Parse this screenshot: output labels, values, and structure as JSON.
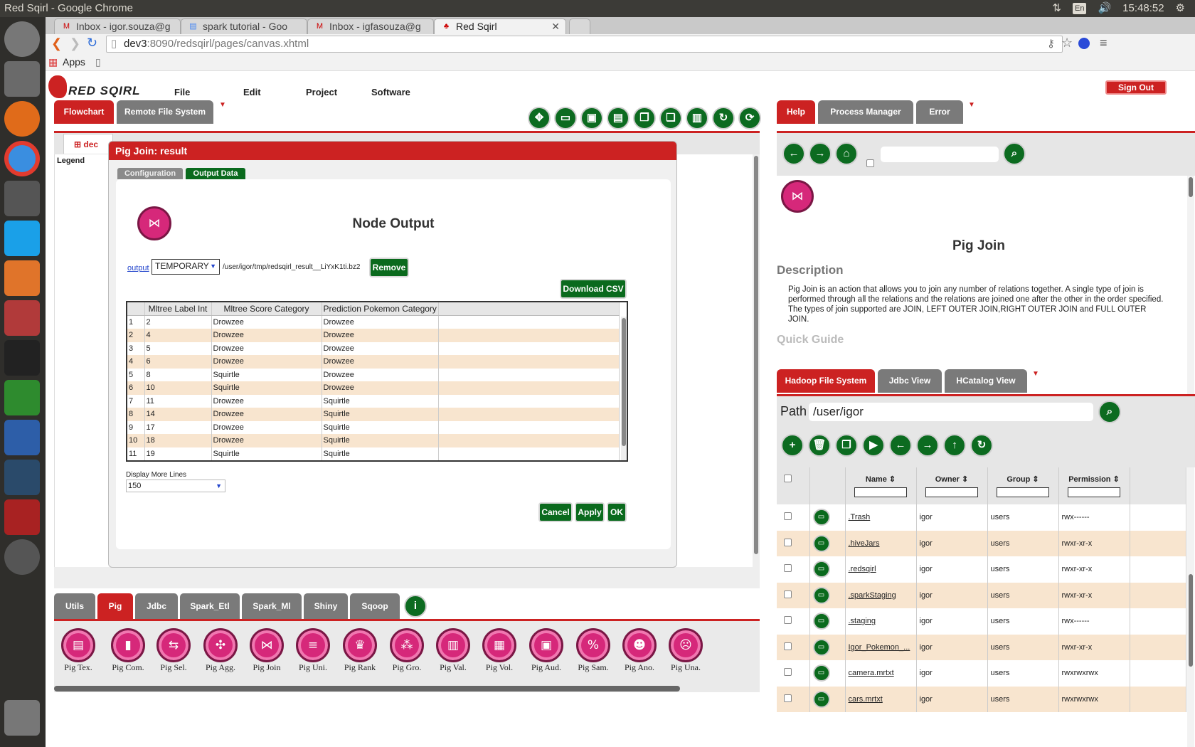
{
  "os": {
    "window_title": "Red Sqirl - Google Chrome",
    "lang": "En",
    "time": "15:48:52"
  },
  "browser": {
    "tabs": [
      {
        "label": "Inbox - igor.souza@g"
      },
      {
        "label": "spark tutorial - Goo"
      },
      {
        "label": "Inbox - igfasouza@g"
      },
      {
        "label": "Red Sqirl"
      }
    ],
    "url_host": "dev3",
    "url_rest": ":8090/redsqirl/pages/canvas.xhtml",
    "apps": "Apps"
  },
  "app": {
    "logo": "RED SQIRL",
    "menu": [
      "File",
      "Edit",
      "Project",
      "Software"
    ],
    "sign_out": "Sign Out",
    "left_tabs": [
      "Flowchart",
      "Remote File System"
    ],
    "canvas_tab": "dec",
    "legend": "Legend",
    "help_tabs": [
      "Help",
      "Process Manager",
      "Error"
    ],
    "help": {
      "title": "Pig Join",
      "desc_heading": "Description",
      "desc": "Pig Join is an action that allows you to join any number of relations together. A single type of join is performed through all the relations and the relations are joined one after the other in the order specified. The types of join supported are JOIN, LEFT OUTER JOIN,RIGHT OUTER JOIN and FULL OUTER JOIN.",
      "quick_guide": "Quick Guide"
    },
    "fs_tabs": [
      "Hadoop File System",
      "Jdbc View",
      "HCatalog View"
    ],
    "fs": {
      "path_label": "Path",
      "path": "/user/igor",
      "headers": [
        "Name",
        "Owner",
        "Group",
        "Permission"
      ],
      "rows": [
        {
          "name": ".Trash",
          "owner": "igor",
          "group": "users",
          "perm": "rwx------"
        },
        {
          "name": ".hiveJars",
          "owner": "igor",
          "group": "users",
          "perm": "rwxr-xr-x"
        },
        {
          "name": ".redsqirl",
          "owner": "igor",
          "group": "users",
          "perm": "rwxr-xr-x"
        },
        {
          "name": ".sparkStaging",
          "owner": "igor",
          "group": "users",
          "perm": "rwxr-xr-x"
        },
        {
          "name": ".staging",
          "owner": "igor",
          "group": "users",
          "perm": "rwx------"
        },
        {
          "name": "Igor_Pokemon_...",
          "owner": "igor",
          "group": "users",
          "perm": "rwxr-xr-x"
        },
        {
          "name": "camera.mrtxt",
          "owner": "igor",
          "group": "users",
          "perm": "rwxrwxrwx"
        },
        {
          "name": "cars.mrtxt",
          "owner": "igor",
          "group": "users",
          "perm": "rwxrwxrwx"
        }
      ]
    },
    "footer_tabs": [
      "Utils",
      "Pig",
      "Jdbc",
      "Spark_Etl",
      "Spark_Ml",
      "Shiny",
      "Sqoop"
    ],
    "nodes": [
      "Pig Tex.",
      "Pig Com.",
      "Pig Sel.",
      "Pig Agg.",
      "Pig Join",
      "Pig Uni.",
      "Pig Rank",
      "Pig Gro.",
      "Pig Val.",
      "Pig Vol.",
      "Pig Aud.",
      "Pig Sam.",
      "Pig Ano.",
      "Pig Una."
    ]
  },
  "dialog": {
    "title": "Pig Join: result",
    "tabs": [
      "Configuration",
      "Output Data"
    ],
    "heading": "Node Output",
    "output_link": "output",
    "output_type": "TEMPORARY",
    "output_path": "/user/igor/tmp/redsqirl_result__LiYxK1ti.bz2",
    "remove": "Remove",
    "download": "Download CSV",
    "headers": [
      "Mltree Label Int",
      "Mltree Score Category",
      "Prediction Pokemon Category"
    ],
    "rows": [
      [
        "1",
        "2",
        "Drowzee",
        "Drowzee"
      ],
      [
        "2",
        "4",
        "Drowzee",
        "Drowzee"
      ],
      [
        "3",
        "5",
        "Drowzee",
        "Drowzee"
      ],
      [
        "4",
        "6",
        "Drowzee",
        "Drowzee"
      ],
      [
        "5",
        "8",
        "Squirtle",
        "Drowzee"
      ],
      [
        "6",
        "10",
        "Squirtle",
        "Drowzee"
      ],
      [
        "7",
        "11",
        "Drowzee",
        "Squirtle"
      ],
      [
        "8",
        "14",
        "Drowzee",
        "Squirtle"
      ],
      [
        "9",
        "17",
        "Drowzee",
        "Squirtle"
      ],
      [
        "10",
        "18",
        "Drowzee",
        "Squirtle"
      ],
      [
        "11",
        "19",
        "Squirtle",
        "Squirtle"
      ]
    ],
    "more_lines_label": "Display More Lines",
    "more_lines_value": "150",
    "cancel": "Cancel",
    "apply": "Apply",
    "ok": "OK"
  }
}
